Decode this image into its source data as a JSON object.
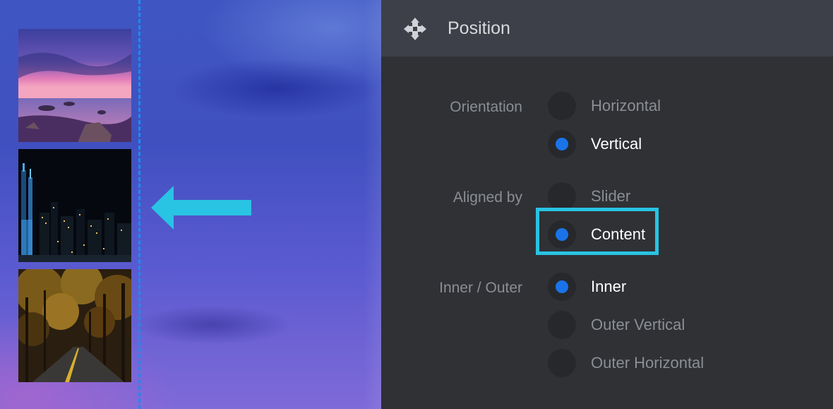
{
  "panel": {
    "title": "Position",
    "title_icon": "move-arrows-icon",
    "groups": [
      {
        "label": "Orientation",
        "options": [
          {
            "label": "Horizontal",
            "checked": false
          },
          {
            "label": "Vertical",
            "checked": true
          }
        ]
      },
      {
        "label": "Aligned by",
        "options": [
          {
            "label": "Slider",
            "checked": false
          },
          {
            "label": "Content",
            "checked": true
          }
        ]
      },
      {
        "label": "Inner / Outer",
        "options": [
          {
            "label": "Inner",
            "checked": true
          },
          {
            "label": "Outer Vertical",
            "checked": false
          },
          {
            "label": "Outer Horizontal",
            "checked": false
          }
        ]
      }
    ]
  },
  "preview": {
    "thumbnails": [
      "seascape-sunset",
      "city-night-skyline",
      "autumn-forest-road"
    ],
    "arrow_icon": "arrow-left-icon"
  },
  "colors": {
    "accent": "#1a73e8",
    "highlight": "#29c3e3",
    "guide_line": "#1a8cf0",
    "panel_bg": "#2f3135",
    "header_bg": "#3d4048"
  }
}
